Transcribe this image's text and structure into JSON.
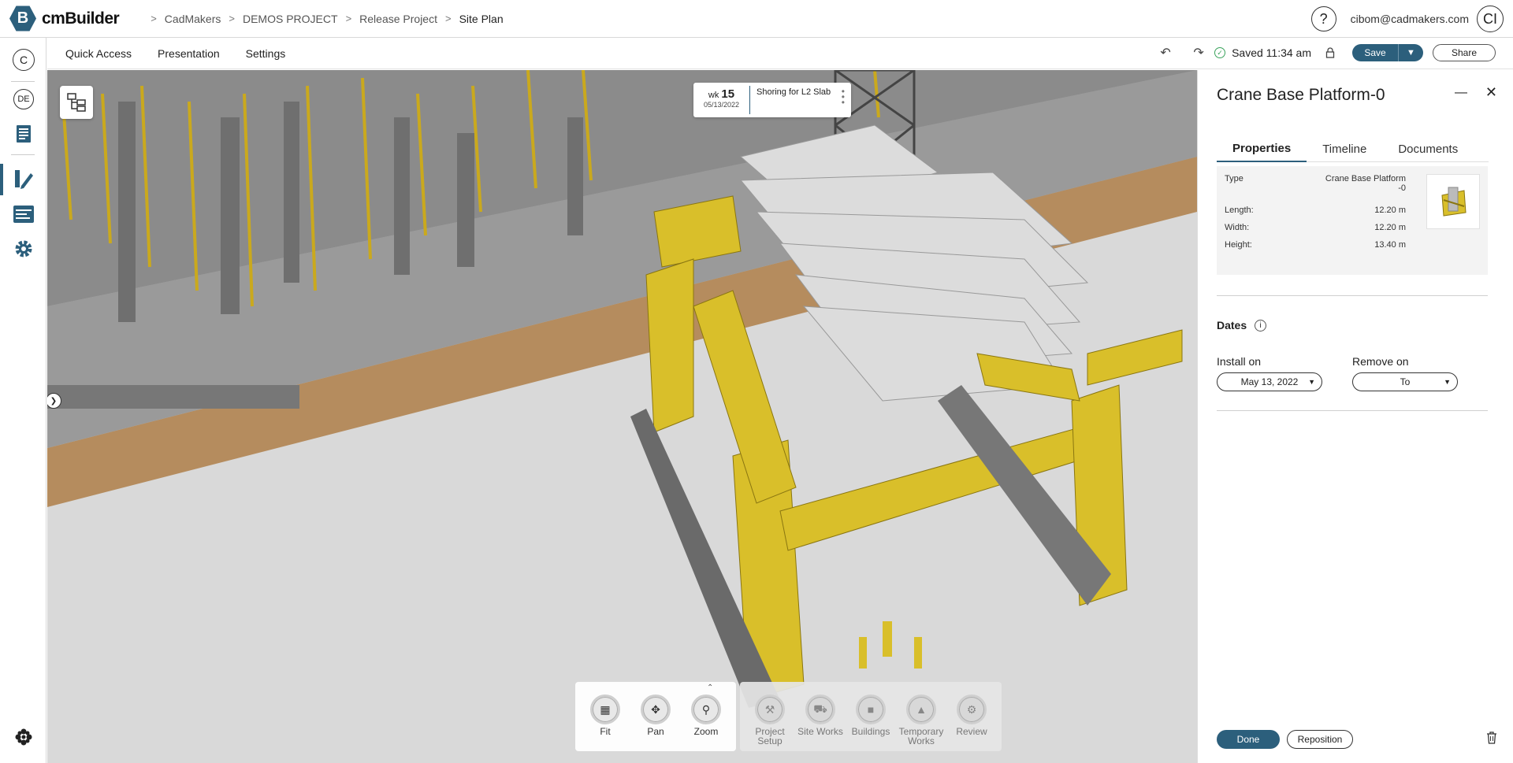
{
  "app": {
    "logo_letter": "B",
    "name": "cmBuilder",
    "brand_color": "#2c5f7c"
  },
  "breadcrumb": [
    "CadMakers",
    "DEMOS PROJECT",
    "Release Project",
    "Site Plan"
  ],
  "user": {
    "help": "?",
    "email": "cibom@cadmakers.com",
    "initials": "CI"
  },
  "rail": {
    "company_initial": "C",
    "project_initials": "DE",
    "icons": [
      "document-icon",
      "design-pen-icon",
      "schedule-icon",
      "settings-gear-icon",
      "apps-icon"
    ]
  },
  "menu": {
    "items": [
      "Quick Access",
      "Presentation",
      "Settings"
    ],
    "saved_text": "Saved 11:34 am",
    "save_label": "Save",
    "share_label": "Share"
  },
  "schedule_card": {
    "wk_label": "wk",
    "week": "15",
    "date": "05/13/2022",
    "task": "Shoring for L2 Slab"
  },
  "tools": {
    "nav": [
      {
        "label": "Fit",
        "icon": "fit-icon"
      },
      {
        "label": "Pan",
        "icon": "pan-icon"
      },
      {
        "label": "Zoom",
        "icon": "zoom-icon"
      }
    ],
    "modes": [
      {
        "label": "Project Setup",
        "icon": "tools-icon"
      },
      {
        "label": "Site Works",
        "icon": "excavator-icon"
      },
      {
        "label": "Buildings",
        "icon": "building-icon"
      },
      {
        "label": "Temporary Works",
        "icon": "crane-icon"
      },
      {
        "label": "Review",
        "icon": "review-icon"
      }
    ]
  },
  "panel": {
    "title": "Crane Base Platform-0",
    "tabs": [
      "Properties",
      "Timeline",
      "Documents"
    ],
    "active_tab": "Properties",
    "properties": {
      "type_label": "Type",
      "type_value_1": "Crane Base Platform",
      "type_value_2": "-0",
      "length_label": "Length:",
      "length_value": "12.20 m",
      "width_label": "Width:",
      "width_value": "12.20 m",
      "height_label": "Height:",
      "height_value": "13.40 m"
    },
    "dates_label": "Dates",
    "install_label": "Install on",
    "install_value": "May 13, 2022",
    "remove_label": "Remove on",
    "remove_value": "To",
    "done_label": "Done",
    "reposition_label": "Reposition"
  }
}
